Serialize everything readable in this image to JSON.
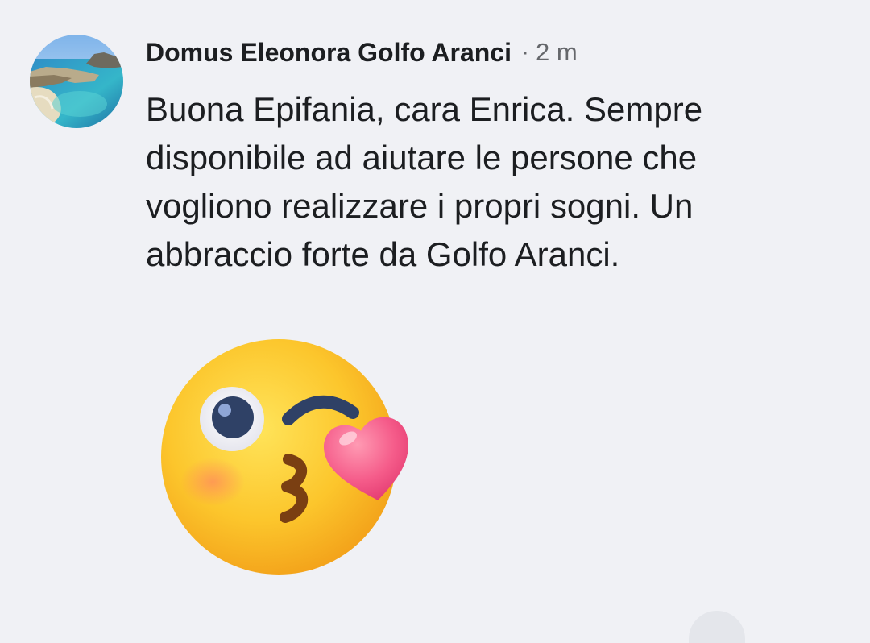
{
  "comment": {
    "author": "Domus Eleonora Golfo Aranci",
    "separator": "·",
    "time": "2 m",
    "text": "Buona Epifania, cara Enrica. Sempre disponibile ad aiutare le persone che vogliono realizzare i propri sogni. Un abbraccio forte da Golfo Aranci.",
    "avatar": "coastal-bay-photo",
    "sticker": "face-blowing-a-kiss-sticker"
  },
  "colors": {
    "background": "#f0f1f5",
    "author_text": "#1c1e21",
    "meta_text": "#65676b",
    "sticker_face": "#fbc531",
    "sticker_heart": "#f25a86"
  }
}
